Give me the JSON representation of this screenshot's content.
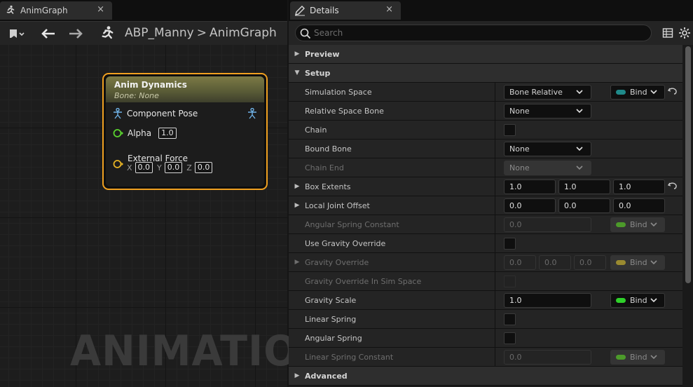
{
  "graph": {
    "tab_title": "AnimGraph",
    "tab_close": "×",
    "breadcrumb": [
      "ABP_Manny",
      "AnimGraph"
    ],
    "breadcrumb_sep": ">",
    "watermark": "ANIMATION",
    "node": {
      "title": "Anim Dynamics",
      "subtitle": "Bone: None",
      "pins": {
        "component_pose": "Component Pose",
        "alpha_label": "Alpha",
        "alpha_value": "1.0",
        "external_force_label": "External Force",
        "x_label": "X",
        "x_value": "0.0",
        "y_label": "Y",
        "y_value": "0.0",
        "z_label": "Z",
        "z_value": "0.0"
      }
    }
  },
  "details": {
    "tab_title": "Details",
    "tab_close": "×",
    "search_placeholder": "Search",
    "categories": {
      "preview": "Preview",
      "setup": "Setup",
      "advanced": "Advanced"
    },
    "rows": {
      "simulation_space": {
        "label": "Simulation Space",
        "value": "Bone Relative",
        "bind": "Bind"
      },
      "relative_space_bone": {
        "label": "Relative Space Bone",
        "value": "None"
      },
      "chain": {
        "label": "Chain"
      },
      "bound_bone": {
        "label": "Bound Bone",
        "value": "None"
      },
      "chain_end": {
        "label": "Chain End",
        "value": "None"
      },
      "box_extents": {
        "label": "Box Extents",
        "values": [
          "1.0",
          "1.0",
          "1.0"
        ]
      },
      "local_joint_offset": {
        "label": "Local Joint Offset",
        "values": [
          "0.0",
          "0.0",
          "0.0"
        ]
      },
      "angular_spring_constant": {
        "label": "Angular Spring Constant",
        "value": "0.0",
        "bind": "Bind"
      },
      "use_gravity_override": {
        "label": "Use Gravity Override"
      },
      "gravity_override": {
        "label": "Gravity Override",
        "values": [
          "0.0",
          "0.0",
          "0.0"
        ],
        "bind": "Bind"
      },
      "gravity_override_sim_space": {
        "label": "Gravity Override In Sim Space"
      },
      "gravity_scale": {
        "label": "Gravity Scale",
        "value": "1.0",
        "bind": "Bind"
      },
      "linear_spring": {
        "label": "Linear Spring"
      },
      "angular_spring": {
        "label": "Angular Spring"
      },
      "linear_spring_constant": {
        "label": "Linear Spring Constant",
        "value": "0.0",
        "bind": "Bind"
      }
    }
  },
  "colors": {
    "node_border": "#f0a020",
    "bind_teal": "#1f8a8a",
    "bind_green_dim": "#4c9a2a",
    "bind_gold_dim": "#9a8a30",
    "bind_green": "#2fd02a",
    "pin_green": "#5bd32f",
    "pin_gold": "#e7b324",
    "pose_blue": "#6fb2e6"
  }
}
